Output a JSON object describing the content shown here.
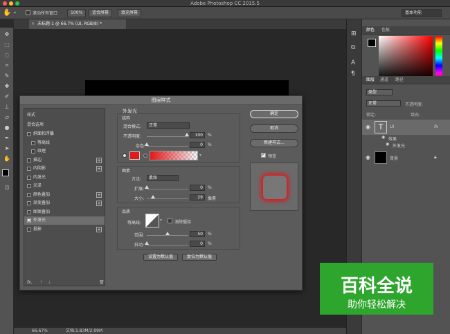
{
  "app": {
    "title": "Adobe Photoshop CC 2015.5"
  },
  "options_bar": {
    "scroll_all_label": "滚动所有窗口",
    "zoom_100": "100%",
    "fit_screen": "适合屏幕",
    "fill_screen": "填充屏幕",
    "workspace": "基本功能"
  },
  "document": {
    "tab_label": "未标题-1 @ 66.7% (UI, RGB/8) *"
  },
  "status": {
    "zoom": "66.67%",
    "doc": "文档:1.83M/2.99M"
  },
  "right_panel": {
    "color_tabs": [
      "颜色",
      "色板"
    ],
    "layer_tabs": [
      "图层",
      "通道",
      "路径"
    ],
    "kind_filter": "类型",
    "blend_mode": "正常",
    "opacity_label": "不透明度:",
    "lock_label": "锁定:",
    "fill_label": "填充:",
    "layers": [
      {
        "name": "UI",
        "thumb": "T",
        "fx": "fx"
      },
      {
        "name": "效果"
      },
      {
        "name": "外发光"
      },
      {
        "name": "背景"
      }
    ]
  },
  "dialog": {
    "title": "图层样式",
    "styles_header": "样式",
    "blend_options": "混合选项",
    "style_items": [
      {
        "label": "斜面和浮雕",
        "checked": false,
        "plus": false,
        "indent": false
      },
      {
        "label": "等高线",
        "checked": false,
        "plus": false,
        "indent": true
      },
      {
        "label": "纹理",
        "checked": false,
        "plus": false,
        "indent": true
      },
      {
        "label": "描边",
        "checked": false,
        "plus": true,
        "indent": false
      },
      {
        "label": "内阴影",
        "checked": false,
        "plus": true,
        "indent": false
      },
      {
        "label": "内发光",
        "checked": false,
        "plus": false,
        "indent": false
      },
      {
        "label": "光泽",
        "checked": false,
        "plus": false,
        "indent": false
      },
      {
        "label": "颜色叠加",
        "checked": false,
        "plus": true,
        "indent": false
      },
      {
        "label": "渐变叠加",
        "checked": false,
        "plus": true,
        "indent": false
      },
      {
        "label": "图案叠加",
        "checked": false,
        "plus": false,
        "indent": false
      },
      {
        "label": "外发光",
        "checked": true,
        "plus": false,
        "indent": false,
        "selected": true
      },
      {
        "label": "投影",
        "checked": false,
        "plus": true,
        "indent": false
      }
    ],
    "fx_label": "fx.",
    "section_title": "外发光",
    "structure": {
      "title": "结构",
      "blend_mode_label": "混合模式:",
      "blend_mode_value": "正常",
      "opacity_label": "不透明度:",
      "opacity_value": "100",
      "noise_label": "杂色:",
      "noise_value": "0",
      "pct": "%",
      "glow_color": "#e0191b"
    },
    "elements": {
      "title": "图素",
      "method_label": "方法:",
      "method_value": "柔和",
      "spread_label": "扩展:",
      "spread_value": "0",
      "size_label": "大小:",
      "size_value": "29",
      "size_unit": "像素"
    },
    "quality": {
      "title": "品质",
      "contour_label": "等高线:",
      "antialias_label": "消除锯齿",
      "range_label": "范围:",
      "range_value": "50",
      "jitter_label": "抖动:",
      "jitter_value": "0"
    },
    "set_default": "设置为默认值",
    "reset_default": "复位为默认值",
    "ok": "确定",
    "cancel": "取消",
    "new_style": "新建样式...",
    "preview_label": "预览"
  },
  "watermark": {
    "line1": "百科全说",
    "line2": "助你轻松解决"
  }
}
